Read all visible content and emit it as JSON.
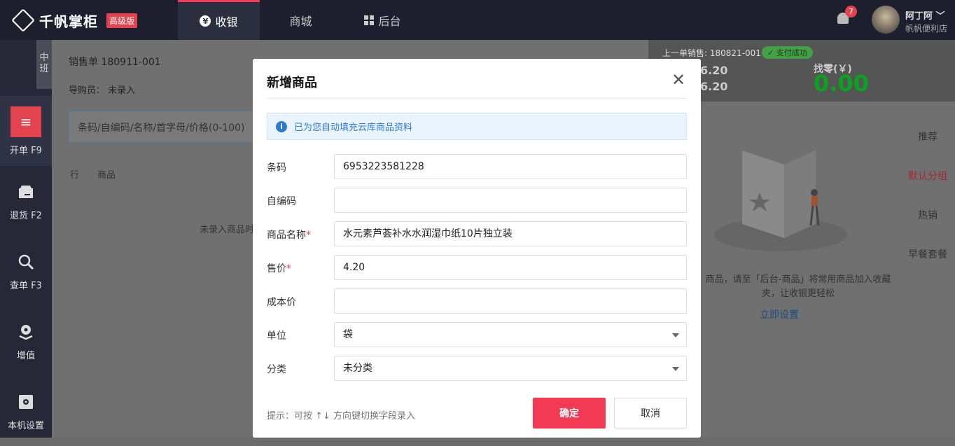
{
  "app": {
    "logo_text": "千帆掌柜",
    "edition": "高级版"
  },
  "nav": [
    {
      "label": "收银",
      "icon": "yen-coin-icon"
    },
    {
      "label": "商城"
    },
    {
      "label": "后台",
      "icon": "grid-icon"
    }
  ],
  "user": {
    "notifications": "7",
    "name": "阿丁阿",
    "store": "帆帆便利店"
  },
  "sidebar": {
    "shift": "中班",
    "items": [
      {
        "label": "开单 F9",
        "icon": "receipt-icon"
      },
      {
        "label": "退货 F2",
        "icon": "return-icon"
      },
      {
        "label": "查单 F3",
        "icon": "search-icon"
      },
      {
        "label": "增值",
        "icon": "value-added-icon"
      },
      {
        "label": "本机设置",
        "icon": "gear-icon"
      }
    ]
  },
  "order": {
    "sale_no": "销售单 180911-001",
    "guide": "导购员： 未录入",
    "search_placeholder": "条码/自编码/名称/首字母/价格(0-100)",
    "col_row": "行",
    "col_product": "商品",
    "empty": "未录入商品时"
  },
  "right_panel": {
    "prev_sale": "上一单销售: 180821-001",
    "paid_badge": "✓ 支付成功",
    "amount1": "6.20",
    "amount2": "6.20",
    "change_label": "找零(￥)",
    "change_value": "0.00",
    "tabs": [
      "推荐",
      "默认分组",
      "热销",
      "早餐套餐"
    ],
    "empty_note": "商品，请至「后台-商品」将常用商品加入收藏夹，让收银更轻松",
    "setup_link": "立即设置"
  },
  "dialog": {
    "title": "新增商品",
    "info": "已为您自动填充云库商品资料",
    "fields": {
      "barcode": {
        "label": "条码",
        "value": "6953223581228"
      },
      "custom_code": {
        "label": "自编码",
        "value": ""
      },
      "name": {
        "label": "商品名称",
        "required": "*",
        "value": "水元素芦荟补水水润湿巾纸10片独立装"
      },
      "price": {
        "label": "售价",
        "required": "*",
        "value": "4.20"
      },
      "cost": {
        "label": "成本价",
        "value": ""
      },
      "unit": {
        "label": "单位",
        "value": "袋"
      },
      "category": {
        "label": "分类",
        "value": "未分类"
      }
    },
    "hint": "提示：可按 ↑↓ 方向键切换字段录入",
    "ok": "确定",
    "cancel": "取消"
  }
}
